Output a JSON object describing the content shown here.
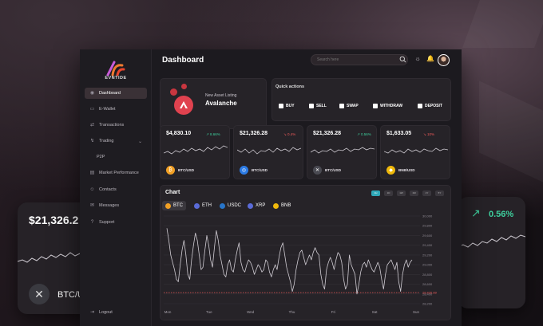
{
  "app": {
    "brand": "EVNTIDE",
    "page_title": "Dashboard",
    "search_placeholder": "Search here"
  },
  "sidebar": {
    "items": [
      {
        "label": "Dashboard",
        "icon": "dashboard-icon",
        "active": true
      },
      {
        "label": "E-Wallet",
        "icon": "wallet-icon"
      },
      {
        "label": "Transactions",
        "icon": "transactions-icon"
      },
      {
        "label": "Trading",
        "icon": "trading-icon",
        "expandable": true
      },
      {
        "label": "P2P",
        "icon": "",
        "sub": true
      },
      {
        "label": "Market Performance",
        "icon": "market-icon"
      },
      {
        "label": "Contacts",
        "icon": "contacts-icon"
      },
      {
        "label": "Messages",
        "icon": "messages-icon"
      },
      {
        "label": "Support",
        "icon": "support-icon"
      }
    ],
    "logout": "Logout"
  },
  "listing": {
    "title": "New Asset Listing",
    "name": "Avalanche"
  },
  "quick_actions": {
    "title": "Quick actions",
    "buttons": [
      "BUY",
      "SELL",
      "SWAP",
      "WITHDRAW",
      "DEPOSIT"
    ]
  },
  "price_cards": [
    {
      "value": "$4,830.10",
      "change": "8.66%",
      "direction": "up",
      "pair": "BTC/USD",
      "coin_color": "#f2a024",
      "coin_glyph": "₿"
    },
    {
      "value": "$21,326.28",
      "change": "0.4%",
      "direction": "down",
      "pair": "BTC/USD",
      "coin_color": "#2c7be5",
      "coin_glyph": "◎"
    },
    {
      "value": "$21,326.28",
      "change": "0.56%",
      "direction": "up",
      "pair": "BTC/USD",
      "coin_color": "#4a4a52",
      "coin_glyph": "✕"
    },
    {
      "value": "$1,633.05",
      "change": "10%",
      "direction": "down",
      "pair": "BNB/USD",
      "coin_color": "#f0b90b",
      "coin_glyph": "◆"
    }
  ],
  "chart": {
    "title": "Chart",
    "timeframes": [
      "1H",
      "1D",
      "1W",
      "1M",
      "1Y",
      "5Y"
    ],
    "assets": [
      {
        "label": "BTC",
        "color": "#f2a024",
        "active": true
      },
      {
        "label": "ETH",
        "color": "#5a6bd8"
      },
      {
        "label": "USDC",
        "color": "#2775ca"
      },
      {
        "label": "XRP",
        "color": "#5a6bd8"
      },
      {
        "label": "BNB",
        "color": "#f0b90b"
      }
    ]
  },
  "chart_data": {
    "type": "line",
    "title": "Chart",
    "x": [
      "Mon",
      "Tue",
      "Wed",
      "Thu",
      "Fri",
      "Sat",
      "Sun"
    ],
    "y_ticks": [
      "30,000",
      "29,800",
      "29,600",
      "29,400",
      "29,200",
      "29,000",
      "28,800",
      "28,600",
      "28,400",
      "28,200"
    ],
    "ylim": [
      28200,
      30000
    ],
    "reference_line": {
      "value": 28426.89,
      "label": "28,426.89",
      "color": "#ef5b5b"
    },
    "series": [
      {
        "color": "#cfcbd2",
        "values": [
          29750,
          29500,
          29200,
          29050,
          28900,
          28700,
          28650,
          29000,
          29300,
          29500,
          29200,
          28800,
          28700,
          29100,
          29400,
          29650,
          29500,
          29200,
          28900,
          28950,
          29300,
          29600,
          29400,
          29100,
          28950,
          29350,
          29700,
          29500,
          29200,
          29000,
          28800,
          28750,
          29000,
          29100,
          28900,
          28850,
          29100,
          29300,
          29450,
          29050,
          28900,
          28850,
          29000,
          29100,
          29050,
          28950,
          28800,
          28900,
          29000,
          28950,
          28850,
          28900,
          29100,
          29050,
          28850,
          28750,
          28900,
          29000,
          28900,
          29150,
          29350,
          29450,
          29200,
          28950,
          28800,
          28650,
          28450,
          28600,
          28900,
          29100,
          29250,
          29300,
          29150,
          29000,
          29100,
          29200,
          29100,
          29250,
          29350,
          29250,
          29200,
          28800,
          28600,
          28500,
          28900,
          29050,
          29150,
          29050,
          28900,
          29100,
          29250,
          29200,
          29050,
          28700,
          28500,
          28600,
          29200,
          29000,
          28900,
          28800,
          28400,
          28600,
          28850,
          29000,
          29050,
          28950,
          29100,
          29000,
          28900,
          28850,
          28950,
          29050,
          28950,
          28700,
          28500,
          28800,
          29000,
          29050,
          29100,
          29000,
          28900,
          29050,
          28650,
          28450,
          28800,
          29000,
          29100,
          28950,
          29050,
          29100
        ]
      }
    ]
  },
  "float_left": {
    "value": "$21,326.2",
    "pair": "BTC/U"
  },
  "float_right": {
    "change": "0.56%"
  },
  "colors": {
    "accent": "#2fa8b8",
    "up": "#3ecf9d",
    "down": "#ef5b5b",
    "card": "#262328"
  }
}
